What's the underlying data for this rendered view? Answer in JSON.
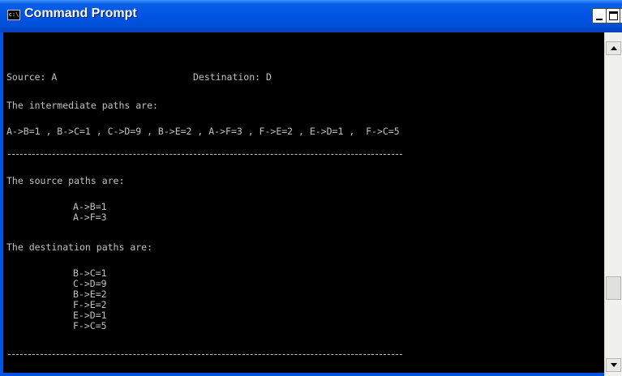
{
  "window": {
    "title": "Command Prompt",
    "icon": "console-icon",
    "icon_glyph": "c:\\",
    "controls": {
      "minimize_icon": "minimize-icon",
      "maximize_icon": "maximize-icon",
      "close_icon": "close-icon",
      "close_glyph": "×"
    }
  },
  "console": {
    "source_label": "Source: A",
    "destination_label": "Destination: D",
    "intermediate_heading": "The intermediate paths are:",
    "intermediate_paths": "A->B=1 , B->C=1 , C->D=9 , B->E=2 , A->F=3 , F->E=2 , E->D=1 ,  F->C=5",
    "source_heading": "The source paths are:",
    "source_paths": [
      "A->B=1",
      "A->F=3"
    ],
    "destination_heading": "The destination paths are:",
    "destination_paths": [
      "B->C=1",
      "C->D=9",
      "B->E=2",
      "F->E=2",
      "E->D=1",
      "F->C=5"
    ]
  },
  "colors": {
    "titlebar": "#0054e3",
    "console_background": "#000000",
    "console_text": "#c0c0c0"
  }
}
